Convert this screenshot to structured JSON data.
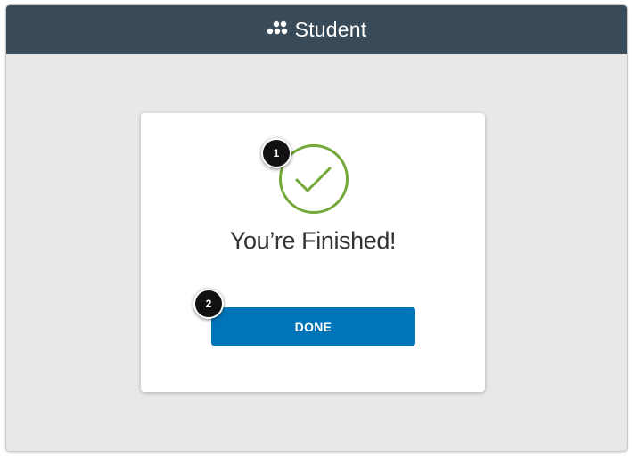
{
  "header": {
    "app_title": "Student",
    "logo_icon": "student-logo-icon",
    "background": "#394b58"
  },
  "card": {
    "status_icon": "checkmark-circle-icon",
    "status_color": "#74a83a",
    "heading": "You’re Finished!",
    "done_label": "DONE",
    "button_color": "#0074b8"
  },
  "callouts": [
    {
      "label": "1"
    },
    {
      "label": "2"
    }
  ]
}
